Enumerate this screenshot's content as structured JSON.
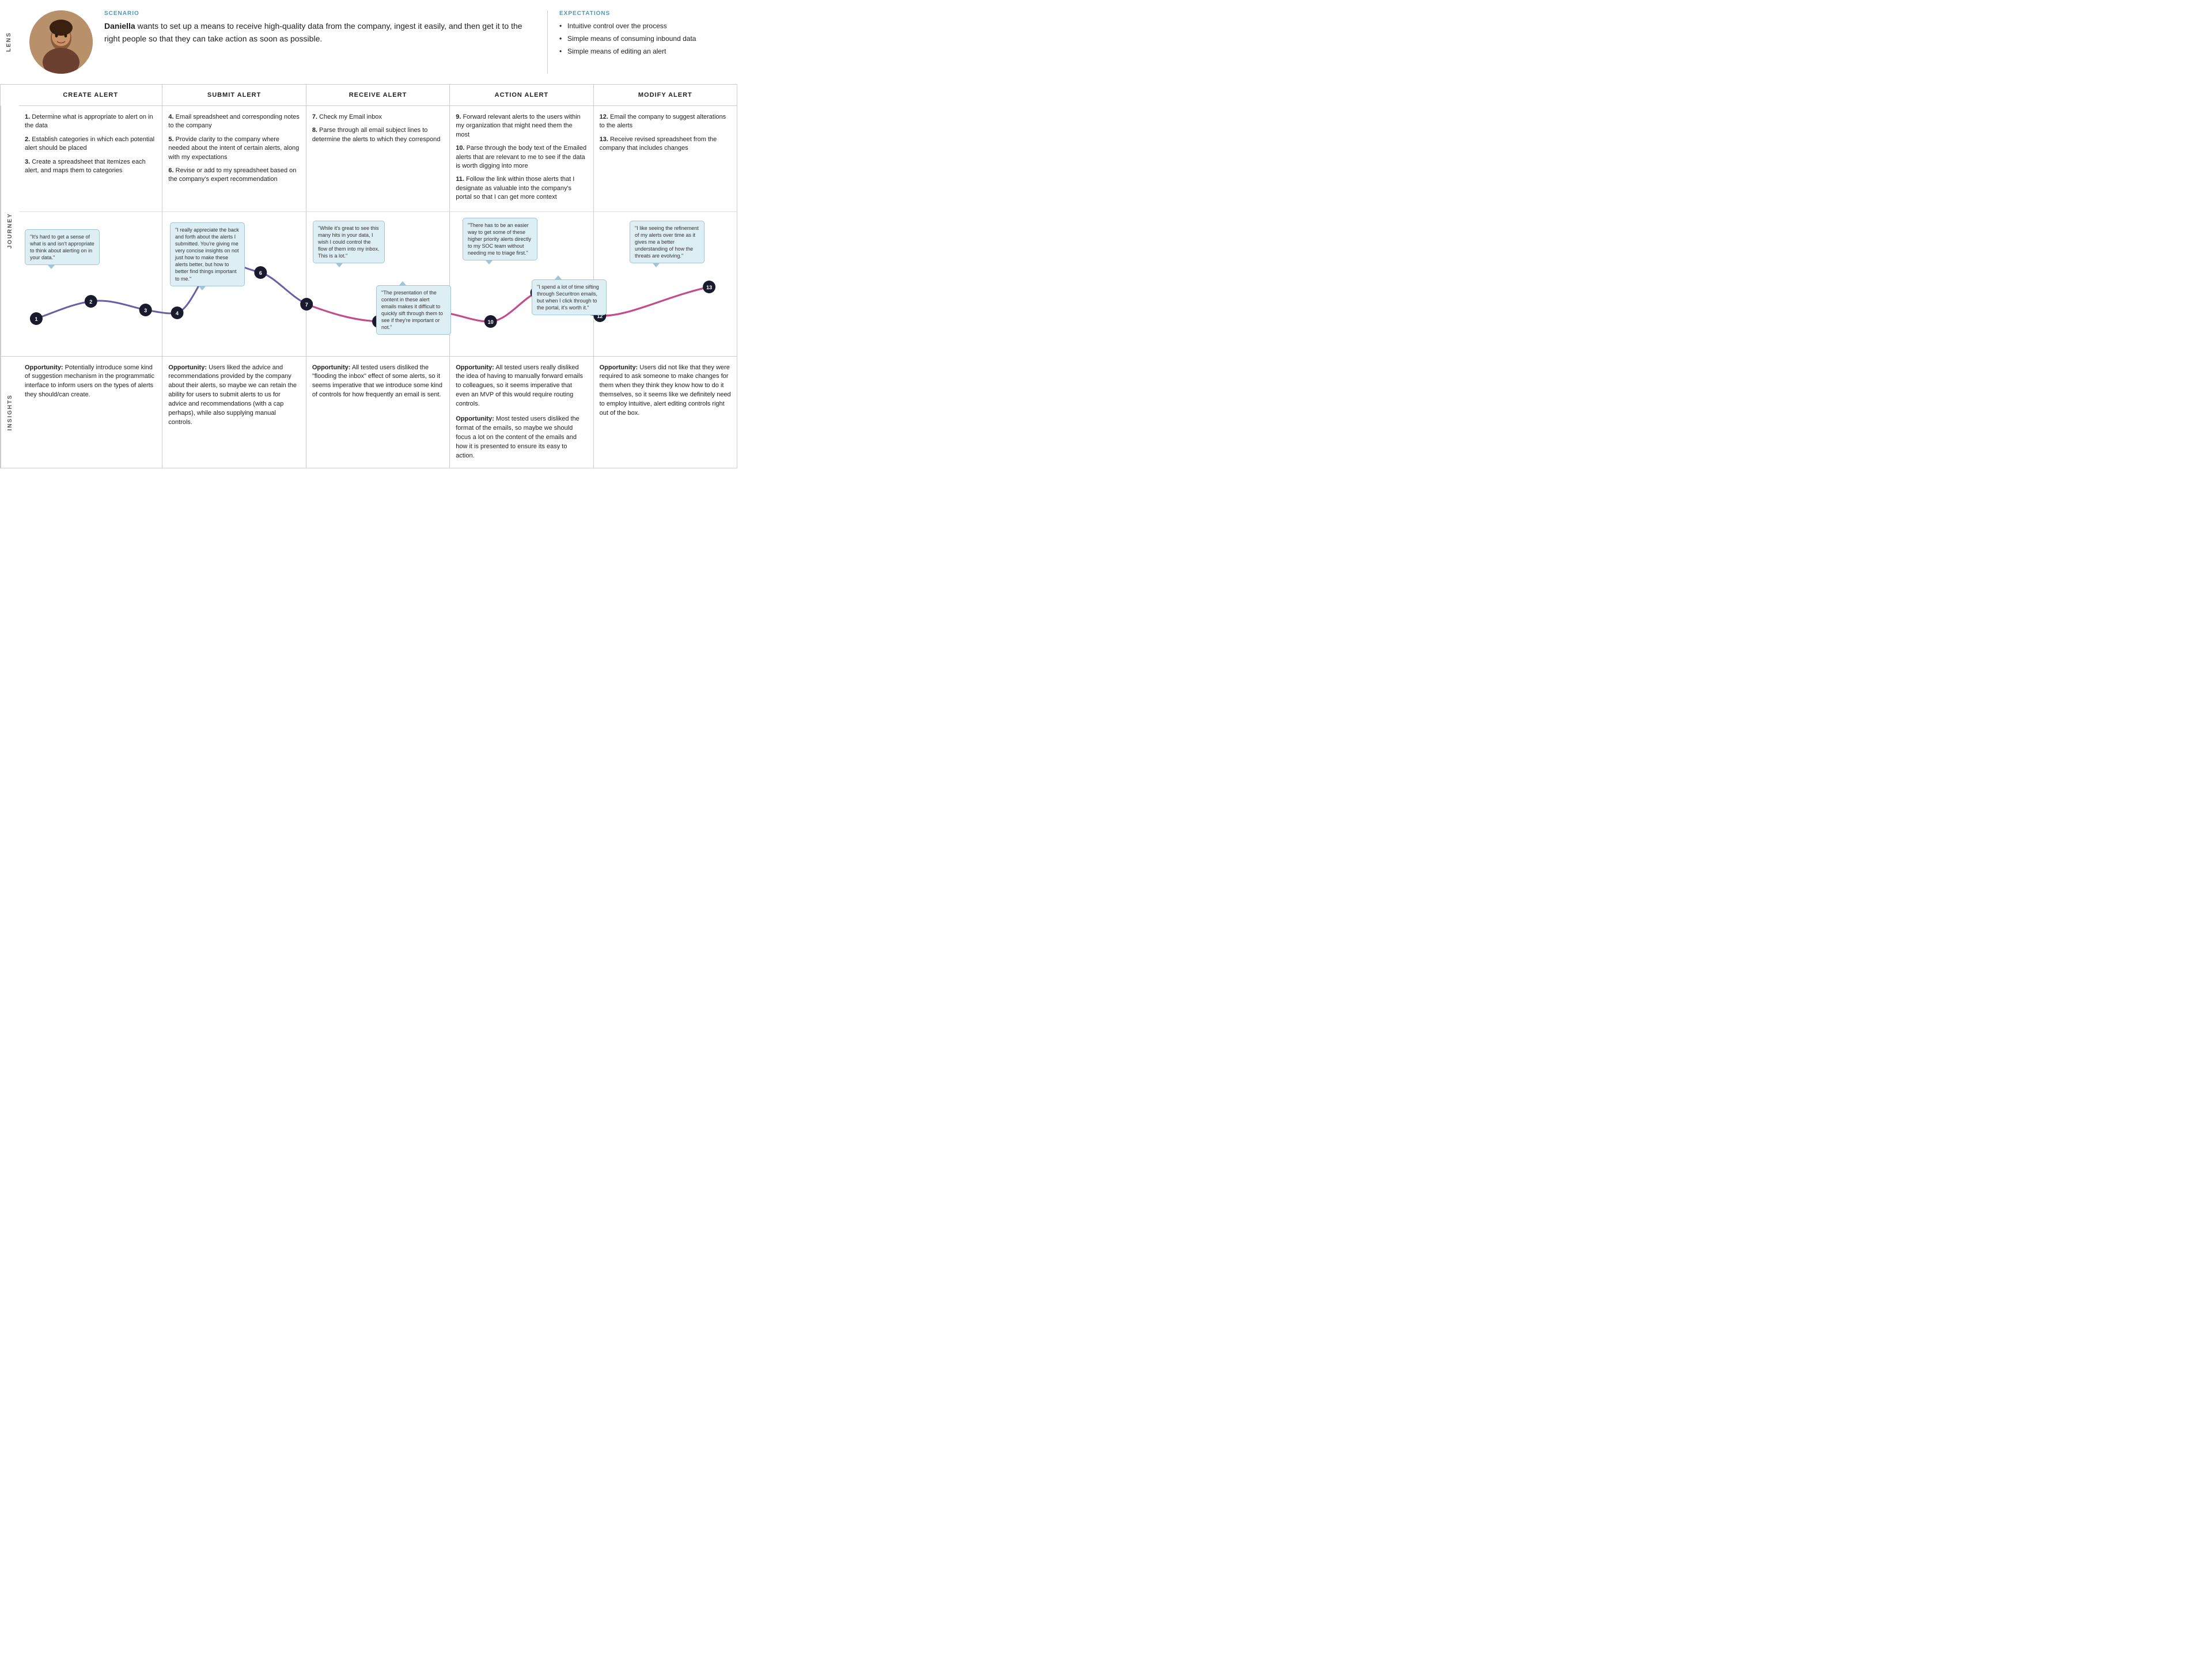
{
  "lens": {
    "label": "LENS",
    "scenario_label": "SCENARIO",
    "scenario_text_intro": "Daniella",
    "scenario_text_rest": " wants to set up a means to receive high-quality data from the company, ingest it easily, and then get it to the right people so that they can take action as soon as possible.",
    "expectations_label": "EXPECTATIONS",
    "expectations": [
      "Intuitive control over the process",
      "Simple means of consuming inbound data",
      "Simple means of editing an alert"
    ]
  },
  "columns": [
    {
      "id": "create",
      "label": "CREATE ALERT"
    },
    {
      "id": "submit",
      "label": "SUBMIT ALERT"
    },
    {
      "id": "receive",
      "label": "RECEIVE ALERT"
    },
    {
      "id": "action",
      "label": "ACTION ALERT"
    },
    {
      "id": "modify",
      "label": "MODIFY ALERT"
    }
  ],
  "journey_label": "JOURNEY",
  "steps": {
    "create": [
      {
        "num": "1.",
        "text": "Determine what is appropriate to alert on in the data"
      },
      {
        "num": "2.",
        "text": "Establish categories in which each potential alert should be placed"
      },
      {
        "num": "3.",
        "text": "Create a spreadsheet that itemizes each alert, and maps them to categories"
      }
    ],
    "submit": [
      {
        "num": "4.",
        "text": "Email spreadsheet and corresponding notes to the company"
      },
      {
        "num": "5.",
        "text": "Provide clarity to the company where needed about the intent of certain alerts, along with my expectations"
      },
      {
        "num": "6.",
        "text": "Revise or add to my spreadsheet based on the company's expert recommendation"
      }
    ],
    "receive": [
      {
        "num": "7.",
        "text": "Check my Email inbox"
      },
      {
        "num": "8.",
        "text": "Parse through all email subject lines to determine the alerts to which they correspond"
      }
    ],
    "action": [
      {
        "num": "9.",
        "text": "Forward relevant alerts to the users within my organization that might need them the most"
      },
      {
        "num": "10.",
        "text": "Parse through the body text of the Emailed alerts that are relevant to me to see if the data is worth digging into more"
      },
      {
        "num": "11.",
        "text": "Follow the link within those alerts that I designate as valuable into the company's portal so that I can get more context"
      }
    ],
    "modify": [
      {
        "num": "12.",
        "text": "Email the company to suggest alterations to the alerts"
      },
      {
        "num": "13.",
        "text": "Receive revised spreadsheet from the company that includes changes"
      }
    ]
  },
  "quotes": [
    {
      "col": 0,
      "text": "\"It's hard to get a sense of what is and isn't appropriate to think about alerting on in your data.\"",
      "node": "2"
    },
    {
      "col": 1,
      "text": "\"I really appreciate the back and forth about the alerts I submitted. You're giving me very concise insights on not just how to make these alerts better, but how to better find things important to me.\"",
      "node": "5"
    },
    {
      "col": 1,
      "text": "\"6.\"",
      "node": "6",
      "is_node": true
    },
    {
      "col": 2,
      "text": "\"While it's great to see this many hits in your data, I wish I could control the flow of them into my inbox. This is a lot.\"",
      "node": "7"
    },
    {
      "col": 2,
      "text": "\"The presentation of the content in these alert emails makes it difficult to quickly sift through them to see if they're important or not.\"",
      "node": "8"
    },
    {
      "col": 3,
      "text": "\"There has to be an easier way to get some of these higher priority alerts directly to my SOC team without needing me to triage first.\"",
      "node": "9"
    },
    {
      "col": 3,
      "text": "\"I spend a lot of time sifting through Securitron emails, but when I click through to the portal, it's worth it.\"",
      "node": "11"
    },
    {
      "col": 4,
      "text": "\"I like seeing the refinement of my alerts over time as it gives me a better understanding of how the threats are evolving.\"",
      "node": "13"
    }
  ],
  "insights_label": "INSIGHTS",
  "insights": [
    {
      "col": "create",
      "text": "Opportunity: Potentially introduce some kind of suggestion mechanism in the programmatic interface to inform users on the types of alerts they should/can create."
    },
    {
      "col": "submit",
      "text": "Opportunity: Users liked the advice and recommendations provided by the company about their alerts, so maybe we can retain the ability for users to submit alerts to us for advice and recommendations (with a cap perhaps), while also supplying manual controls."
    },
    {
      "col": "receive",
      "text": "Opportunity: All tested users disliked the \"flooding the inbox\" effect of some alerts, so it seems imperative that we introduce some kind of controls for how frequently an email is sent."
    },
    {
      "col": "action",
      "text_1": "Opportunity: All tested users really disliked the idea of having to manually forward emails to colleagues, so it seems imperative that even an MVP of this would require routing controls.",
      "text_2": "Opportunity: Most tested users disliked the format of the emails, so maybe we should focus a lot on the content of the emails and how it is presented to ensure its easy to action."
    },
    {
      "col": "modify",
      "text": "Opportunity: Users did not like that they were required to ask someone to make changes for them when they think they know how to do it themselves, so it seems like we definitely need to employ intuitive, alert editing controls right out of the box."
    }
  ],
  "colors": {
    "accent_blue": "#4a9aba",
    "path_purple": "#6b5ea8",
    "path_pink": "#c94a8a",
    "node_dark": "#1a1a2e",
    "bubble_bg": "#e8f4f8",
    "bubble_border": "#a0c8dc"
  }
}
